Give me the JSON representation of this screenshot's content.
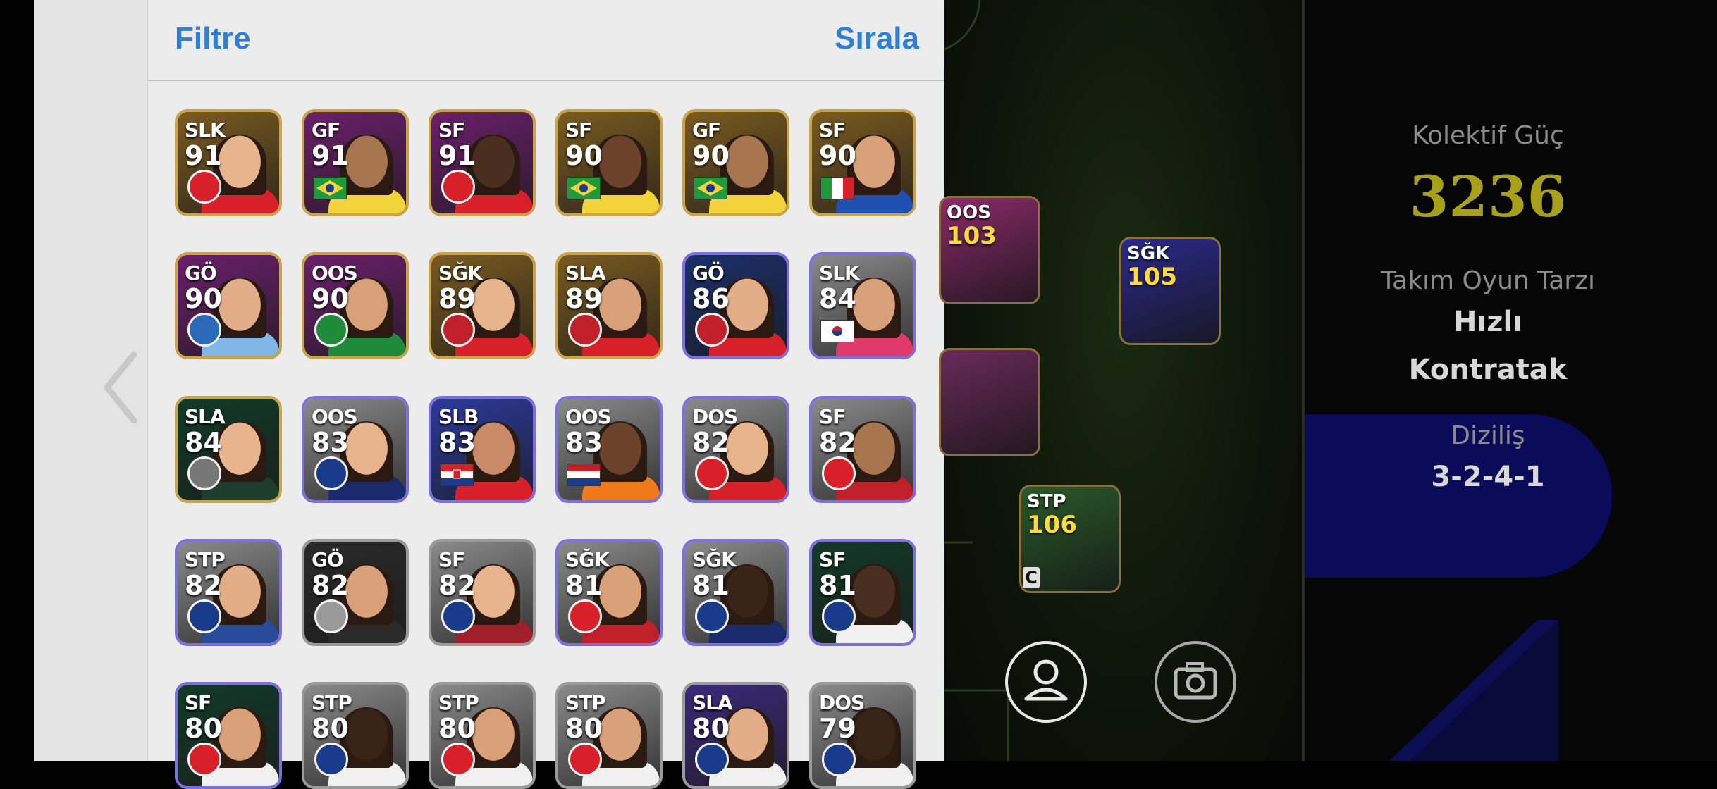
{
  "header": {
    "filter_label": "Filtre",
    "sort_label": "Sıralа"
  },
  "players": [
    {
      "pos": "SLK",
      "rating": "91",
      "bg": "#7a5a20",
      "frame": "#c9a44a",
      "kit": "#d8202a",
      "skin": "#e8b48e",
      "badge": "club",
      "badge_color": "#d8202a"
    },
    {
      "pos": "GF",
      "rating": "91",
      "bg": "#6b1f6b",
      "frame": "#c9a44a",
      "kit": "#f2d33a",
      "skin": "#a77650",
      "badge": "flag-br"
    },
    {
      "pos": "SF",
      "rating": "91",
      "bg": "#6b1f6b",
      "frame": "#c9a44a",
      "kit": "#d8202a",
      "skin": "#4a2e20",
      "badge": "club",
      "badge_color": "#d8202a"
    },
    {
      "pos": "SF",
      "rating": "90",
      "bg": "#7a5a20",
      "frame": "#c9a44a",
      "kit": "#f2d33a",
      "skin": "#6b432b",
      "badge": "flag-br"
    },
    {
      "pos": "GF",
      "rating": "90",
      "bg": "#7a5a20",
      "frame": "#c9a44a",
      "kit": "#f2d33a",
      "skin": "#a77650",
      "badge": "flag-br"
    },
    {
      "pos": "SF",
      "rating": "90",
      "bg": "#7a5a20",
      "frame": "#c9a44a",
      "kit": "#1f4fb0",
      "skin": "#d9a17a",
      "badge": "flag-it"
    },
    {
      "pos": "GÖ",
      "rating": "90",
      "bg": "#6b1f6b",
      "frame": "#c9a44a",
      "kit": "#7fb6e6",
      "skin": "#e2ad88",
      "badge": "club",
      "badge_color": "#2a6ab8"
    },
    {
      "pos": "OOS",
      "rating": "90",
      "bg": "#6b1f6b",
      "frame": "#c9a44a",
      "kit": "#1e8a3a",
      "skin": "#d9a17a",
      "badge": "club",
      "badge_color": "#1e8a3a"
    },
    {
      "pos": "SĞK",
      "rating": "89",
      "bg": "#7a5a20",
      "frame": "#c9a44a",
      "kit": "#d8202a",
      "skin": "#e8b48e",
      "badge": "club",
      "badge_color": "#c0202a"
    },
    {
      "pos": "SLA",
      "rating": "89",
      "bg": "#7a5a20",
      "frame": "#c9a44a",
      "kit": "#d8202a",
      "skin": "#d9a17a",
      "badge": "club",
      "badge_color": "#c0202a"
    },
    {
      "pos": "GÖ",
      "rating": "86",
      "bg": "#1b2f6a",
      "frame": "#7d6fe0",
      "kit": "#d8202a",
      "skin": "#e2ad88",
      "badge": "club",
      "badge_color": "#c0202a"
    },
    {
      "pos": "SLK",
      "rating": "84",
      "bg": "#8a8a8a",
      "frame": "#7d6fe0",
      "kit": "#e03a6a",
      "skin": "#d9a17a",
      "badge": "flag-kr"
    },
    {
      "pos": "SLA",
      "rating": "84",
      "bg": "#123a2a",
      "frame": "#c9a44a",
      "kit": "#1e3d2c",
      "skin": "#e8b48e",
      "badge": "club",
      "badge_color": "#777777"
    },
    {
      "pos": "OOS",
      "rating": "83",
      "bg": "#8a8a8a",
      "frame": "#7d6fe0",
      "kit": "#1a2a6a",
      "skin": "#e8b48e",
      "badge": "club",
      "badge_color": "#1a3a8a"
    },
    {
      "pos": "SLB",
      "rating": "83",
      "bg": "#2b3a9a",
      "frame": "#7d6fe0",
      "kit": "#d8202a",
      "skin": "#c98a6a",
      "badge": "flag-hr"
    },
    {
      "pos": "OOS",
      "rating": "83",
      "bg": "#8a8a8a",
      "frame": "#7d6fe0",
      "kit": "#f07a1a",
      "skin": "#6b432b",
      "badge": "flag-nl"
    },
    {
      "pos": "DOS",
      "rating": "82",
      "bg": "#8a8a8a",
      "frame": "#7d6fe0",
      "kit": "#d8202a",
      "skin": "#e8b48e",
      "badge": "club",
      "badge_color": "#d8202a"
    },
    {
      "pos": "SF",
      "rating": "82",
      "bg": "#8a8a8a",
      "frame": "#7d6fe0",
      "kit": "#c0202a",
      "skin": "#a77650",
      "badge": "club",
      "badge_color": "#d8202a"
    },
    {
      "pos": "STP",
      "rating": "82",
      "bg": "#8a8a8a",
      "frame": "#7d6fe0",
      "kit": "#2a4a9a",
      "skin": "#e2ad88",
      "badge": "club",
      "badge_color": "#1a3a8a"
    },
    {
      "pos": "GÖ",
      "rating": "82",
      "bg": "#2a2a2a",
      "frame": "#9a9a9a",
      "kit": "#2a2a2a",
      "skin": "#d9a17a",
      "badge": "club",
      "badge_color": "#999999"
    },
    {
      "pos": "SF",
      "rating": "82",
      "bg": "#8a8a8a",
      "frame": "#9a9a9a",
      "kit": "#a0202a",
      "skin": "#e8b48e",
      "badge": "club",
      "badge_color": "#1a3a8a"
    },
    {
      "pos": "SĞK",
      "rating": "81",
      "bg": "#8a8a8a",
      "frame": "#7d6fe0",
      "kit": "#c0202a",
      "skin": "#d9a17a",
      "badge": "club",
      "badge_color": "#d8202a"
    },
    {
      "pos": "SĞK",
      "rating": "81",
      "bg": "#8a8a8a",
      "frame": "#7d6fe0",
      "kit": "#1a2a6a",
      "skin": "#3a2418",
      "badge": "club",
      "badge_color": "#1a3a8a"
    },
    {
      "pos": "SF",
      "rating": "81",
      "bg": "#123a2a",
      "frame": "#7d6fe0",
      "kit": "#f0f0f0",
      "skin": "#4a2e20",
      "badge": "club",
      "badge_color": "#1a3a8a"
    },
    {
      "pos": "SF",
      "rating": "80",
      "bg": "#123a2a",
      "frame": "#7d6fe0",
      "kit": "#f0f0f0",
      "skin": "#d9a17a",
      "badge": "club",
      "badge_color": "#d8202a"
    },
    {
      "pos": "STP",
      "rating": "80",
      "bg": "#8a8a8a",
      "frame": "#9a9a9a",
      "kit": "#f0f0f0",
      "skin": "#3a2418",
      "badge": "club",
      "badge_color": "#1a3a8a"
    },
    {
      "pos": "STP",
      "rating": "80",
      "bg": "#8a8a8a",
      "frame": "#9a9a9a",
      "kit": "#f0f0f0",
      "skin": "#d9a17a",
      "badge": "club",
      "badge_color": "#d8202a"
    },
    {
      "pos": "STP",
      "rating": "80",
      "bg": "#8a8a8a",
      "frame": "#9a9a9a",
      "kit": "#f0f0f0",
      "skin": "#d9a17a",
      "badge": "club",
      "badge_color": "#d8202a"
    },
    {
      "pos": "SLA",
      "rating": "80",
      "bg": "#3a2a7a",
      "frame": "#9a9a9a",
      "kit": "#f0f0f0",
      "skin": "#e2ad88",
      "badge": "club",
      "badge_color": "#1a3a8a"
    },
    {
      "pos": "DOS",
      "rating": "79",
      "bg": "#8a8a8a",
      "frame": "#9a9a9a",
      "kit": "#f0f0f0",
      "skin": "#3a2418",
      "badge": "club",
      "badge_color": "#1a3a8a"
    }
  ],
  "field_cards": [
    {
      "pos": "OOS",
      "rating": "103",
      "bg": "#8a2a6a"
    },
    {
      "pos": "SĞK",
      "rating": "105",
      "bg": "#2a2a8a"
    },
    {
      "pos": "",
      "rating": "",
      "bg": "#6a2a5a"
    },
    {
      "pos": "STP",
      "rating": "106",
      "bg": "#2a5a2a"
    }
  ],
  "captain_label": "C",
  "info": {
    "power_label": "Kolektif Güç",
    "power_value": "3236",
    "style_label": "Takım Oyun Tarzı",
    "style_value_1": "Hızlı",
    "style_value_2": "Kontratak",
    "formation_label": "Diziliş",
    "formation_value": "3-2-4-1"
  },
  "icons": [
    "chevron-left-icon",
    "person-icon",
    "camera-icon"
  ],
  "colors": {
    "accent": "#2f7fd6",
    "power": "#a9a019",
    "formation_bg": "#0a0c5a"
  }
}
